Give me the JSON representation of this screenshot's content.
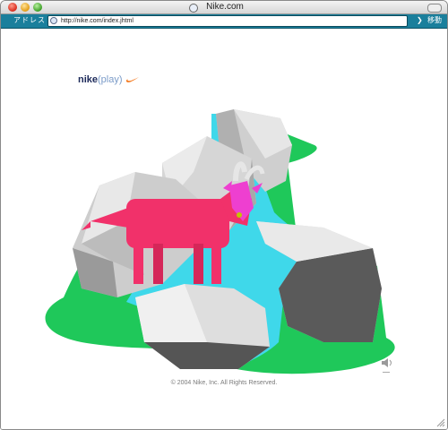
{
  "window": {
    "title": "Nike.com"
  },
  "address_bar": {
    "label": "アドレス",
    "url": "http://nike.com/index.jhtml",
    "go_label": "移動"
  },
  "page": {
    "logo": {
      "brand": "nike",
      "suffix": "(play)"
    },
    "copyright": "© 2004 Nike, Inc. All Rights Reserved."
  },
  "colors": {
    "accent_teal": "#1a7f9c",
    "grass_green": "#1fc85a",
    "water_cyan": "#3fd8ea",
    "goat_pink": "#f1316a",
    "swoosh_orange": "#f47a1f"
  },
  "icons": {
    "speaker": "speaker-icon",
    "globe": "globe-icon"
  }
}
